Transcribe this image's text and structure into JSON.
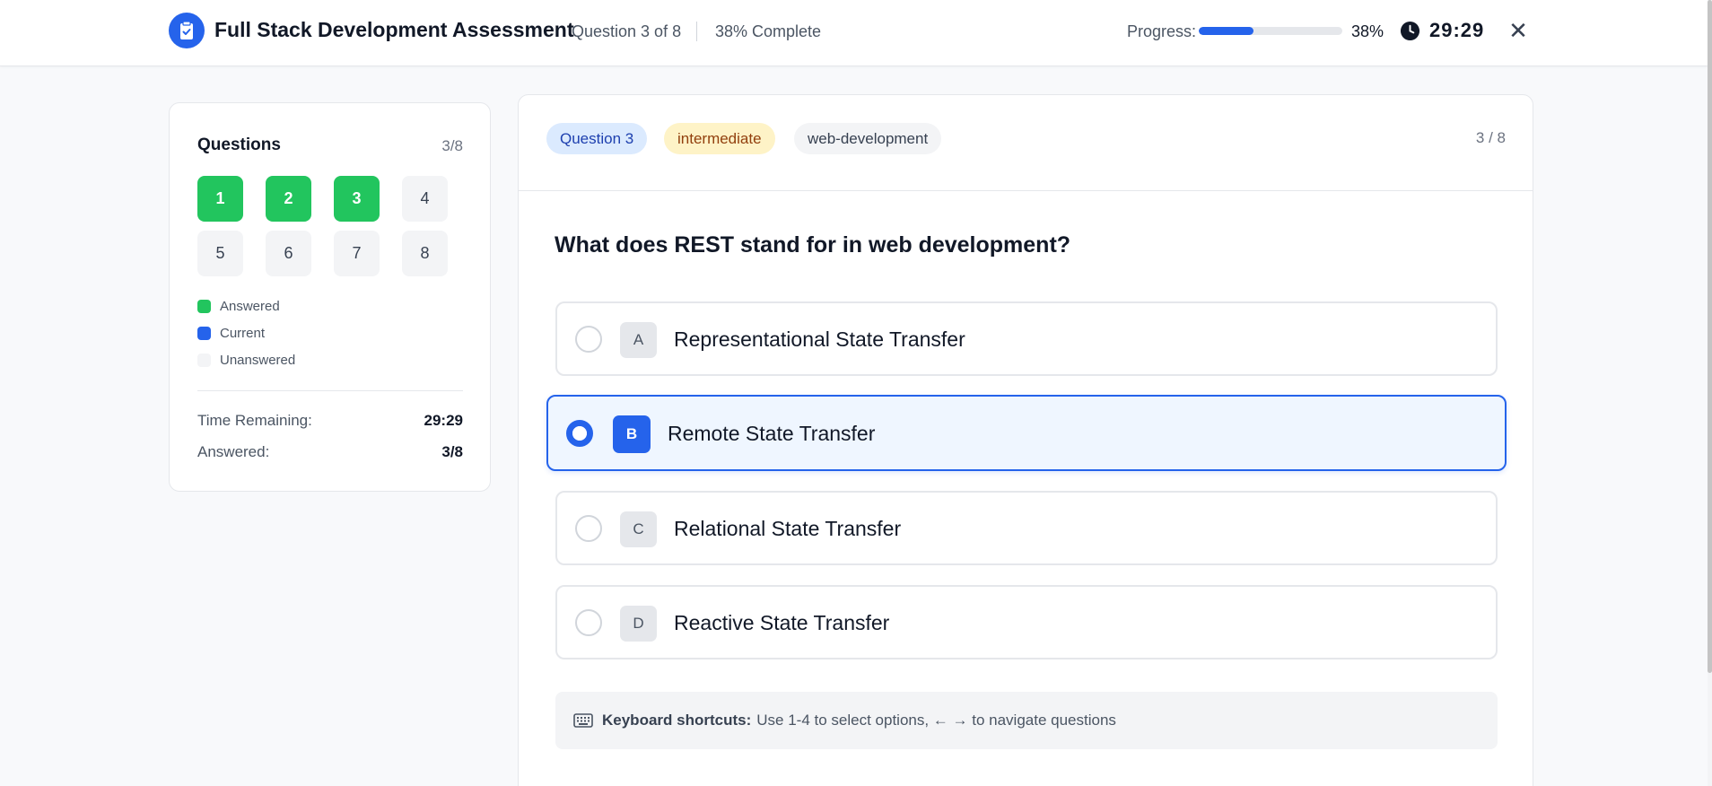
{
  "header": {
    "title": "Full Stack Development Assessment",
    "question_count": "Question 3 of 8",
    "complete": "38% Complete",
    "progress_label": "Progress:",
    "progress_fraction": 0.38,
    "progress_pct": "38%",
    "timer": "29:29",
    "close_glyph": "✕"
  },
  "sidebar": {
    "title": "Questions",
    "count": "3/8",
    "questions": [
      {
        "num": "1",
        "state": "answered"
      },
      {
        "num": "2",
        "state": "answered"
      },
      {
        "num": "3",
        "state": "answered"
      },
      {
        "num": "4",
        "state": "unanswered"
      },
      {
        "num": "5",
        "state": "unanswered"
      },
      {
        "num": "6",
        "state": "unanswered"
      },
      {
        "num": "7",
        "state": "unanswered"
      },
      {
        "num": "8",
        "state": "unanswered"
      }
    ],
    "legend": [
      {
        "label": "Answered",
        "color": "#22c55e"
      },
      {
        "label": "Current",
        "color": "#2563eb"
      },
      {
        "label": "Unanswered",
        "color": "#f3f4f6"
      }
    ],
    "time_remaining_label": "Time Remaining:",
    "time_remaining_value": "29:29",
    "answered_label": "Answered:",
    "answered_value": "3/8"
  },
  "card": {
    "tag_question": "Question 3",
    "tag_level": "intermediate",
    "tag_category": "web-development",
    "position": "3 / 8",
    "question": "What does REST stand for in web development?",
    "options": [
      {
        "letter": "A",
        "text": "Representational State Transfer",
        "selected": false
      },
      {
        "letter": "B",
        "text": "Remote State Transfer",
        "selected": true
      },
      {
        "letter": "C",
        "text": "Relational State Transfer",
        "selected": false
      },
      {
        "letter": "D",
        "text": "Reactive State Transfer",
        "selected": false
      }
    ],
    "shortcuts_label": "Keyboard shortcuts:",
    "shortcuts_text": "Use 1-4 to select options, ← → to navigate questions"
  },
  "colors": {
    "accent": "#2563eb",
    "answered": "#22c55e",
    "level_bg": "#fef3c7"
  },
  "icons": {
    "logo": "clipboard-check-icon",
    "clock": "clock-icon",
    "close": "close-icon",
    "keyboard": "keyboard-icon"
  }
}
